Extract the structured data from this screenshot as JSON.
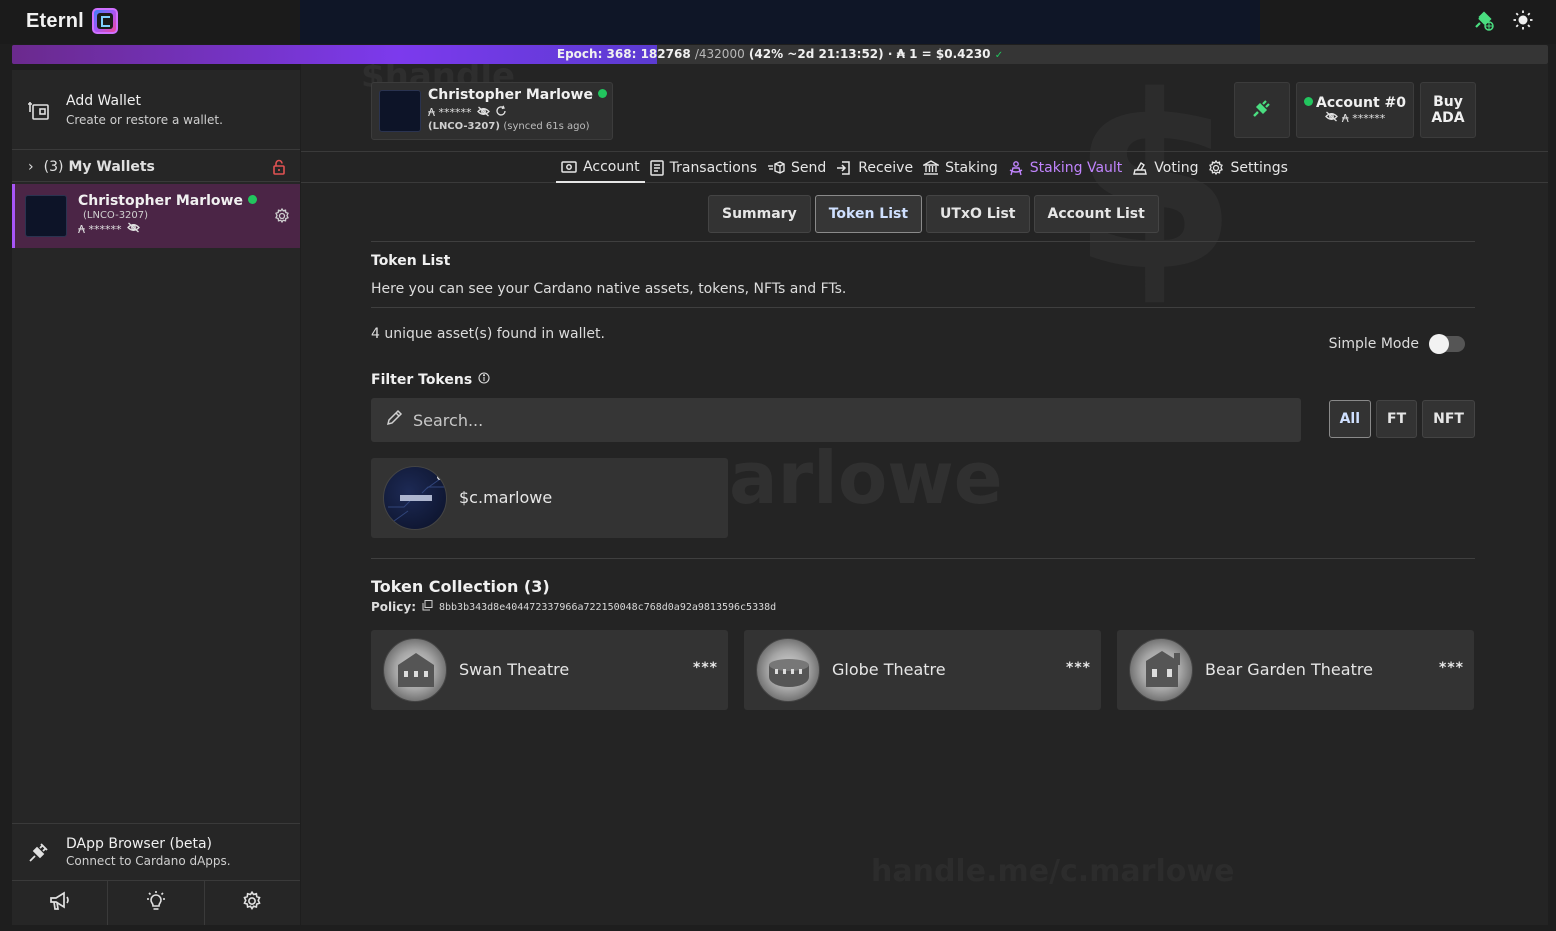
{
  "app": {
    "name": "Eternl"
  },
  "epoch": {
    "label": "Epoch: 368: 182768",
    "total": "/432000",
    "progress_text": "(42% ~2d 21:13:52)",
    "price": "· ₳ 1 = $0.4230",
    "progress": 0.42
  },
  "sidebar": {
    "add_wallet_title": "Add Wallet",
    "add_wallet_sub": "Create or restore a wallet.",
    "my_wallets_count": "(3)",
    "my_wallets_label": "My Wallets",
    "wallet": {
      "name": "Christopher Marlowe",
      "id": "(LNCO-3207)",
      "balance": "₳ ******"
    },
    "dapp_title": "DApp Browser (beta)",
    "dapp_sub": "Connect to Cardano dApps."
  },
  "header": {
    "wallet_name": "Christopher Marlowe",
    "wallet_balance": "₳ ******",
    "wallet_id": "(LNCO-3207)",
    "sync_status": "(synced 61s ago)",
    "account_label": "Account #0",
    "account_balance": "₳ ******",
    "buy_line1": "Buy",
    "buy_line2": "ADA"
  },
  "tabs": [
    "Account",
    "Transactions",
    "Send",
    "Receive",
    "Staking",
    "Staking Vault",
    "Voting",
    "Settings"
  ],
  "subtabs": [
    "Summary",
    "Token List",
    "UTxO List",
    "Account List"
  ],
  "token_list": {
    "title": "Token List",
    "description": "Here you can see your Cardano native assets, tokens, NFTs and FTs.",
    "found": "4 unique asset(s) found in wallet.",
    "simple_mode": "Simple Mode",
    "filter_title": "Filter Tokens",
    "search_placeholder": "Search...",
    "filters": [
      "All",
      "FT",
      "NFT"
    ],
    "handle_name": "$c.marlowe"
  },
  "collection": {
    "title": "Token Collection (3)",
    "policy_label": "Policy:",
    "policy_id": "8bb3b343d8e404472337966a722150048c768d0a92a9813596c5338d",
    "items": [
      {
        "name": "Swan Theatre",
        "stars": "***"
      },
      {
        "name": "Globe Theatre",
        "stars": "***"
      },
      {
        "name": "Bear Garden Theatre",
        "stars": "***"
      }
    ]
  },
  "watermark": {
    "handle": "$handle",
    "dollar": "$",
    "name": "c.marlowe",
    "url": "handle.me/c.marlowe"
  },
  "colors": {
    "accent": "#a855f7",
    "online": "#22c55e",
    "plug": "#4ade80"
  }
}
